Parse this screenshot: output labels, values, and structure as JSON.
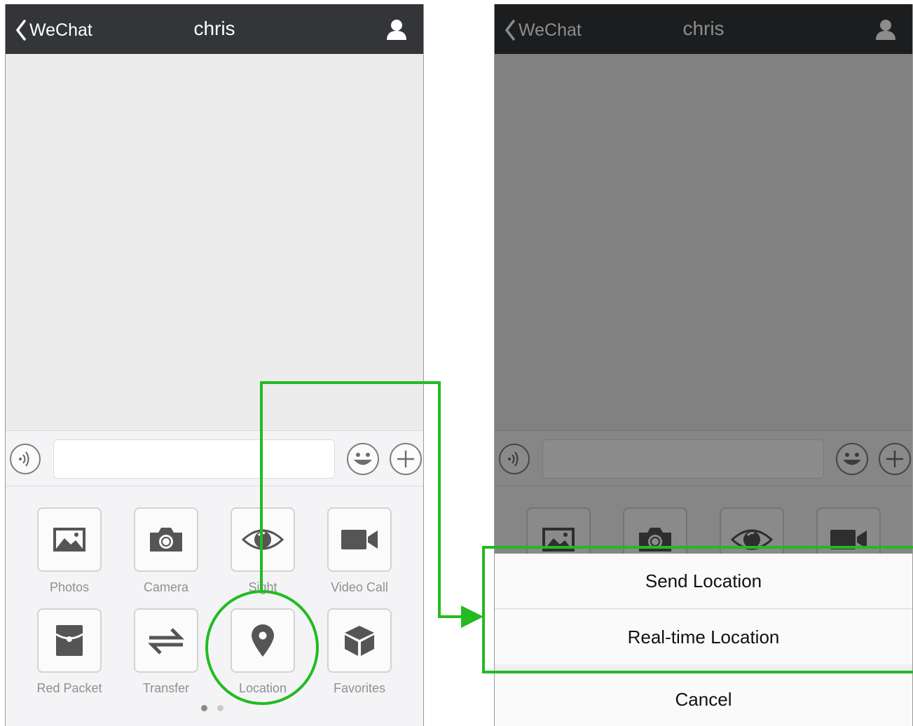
{
  "colors": {
    "navbar": "#333538",
    "highlight_green": "#22bb22",
    "panel_bg": "#f4f4f6",
    "label_gray": "#909090"
  },
  "left_screen": {
    "nav": {
      "back_label": "WeChat",
      "title": "chris",
      "back_icon": "chevron-left-icon",
      "profile_icon": "person-icon"
    },
    "input_bar": {
      "voice_icon": "voice-icon",
      "message_value": "",
      "emoji_icon": "smiley-icon",
      "plus_icon": "plus-icon"
    },
    "tools": [
      {
        "label": "Photos",
        "icon": "photo-icon"
      },
      {
        "label": "Camera",
        "icon": "camera-icon"
      },
      {
        "label": "Sight",
        "icon": "eye-icon"
      },
      {
        "label": "Video Call",
        "icon": "video-icon"
      },
      {
        "label": "Red Packet",
        "icon": "red-packet-icon"
      },
      {
        "label": "Transfer",
        "icon": "transfer-icon"
      },
      {
        "label": "Location",
        "icon": "location-pin-icon"
      },
      {
        "label": "Favorites",
        "icon": "cube-icon"
      }
    ],
    "page_indicator": {
      "current": 1,
      "total": 2
    }
  },
  "right_screen": {
    "nav": {
      "back_label": "WeChat",
      "title": "chris"
    },
    "action_sheet": {
      "send_location": "Send Location",
      "realtime_location": "Real-time Location",
      "cancel": "Cancel"
    }
  }
}
